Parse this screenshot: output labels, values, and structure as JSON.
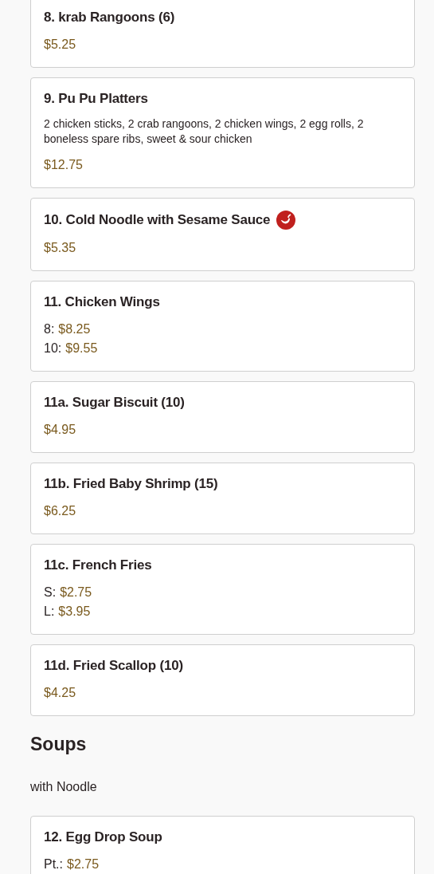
{
  "sections": [
    {
      "items": [
        {
          "name": "8. krab Rangoons (6)",
          "spicy": false,
          "prices": [
            {
              "price": "$5.25"
            }
          ]
        },
        {
          "name": "9. Pu Pu Platters",
          "spicy": false,
          "description": "2 chicken sticks, 2 crab rangoons, 2 chicken wings, 2 egg rolls, 2 boneless spare ribs, sweet & sour chicken",
          "prices": [
            {
              "price": "$12.75"
            }
          ]
        },
        {
          "name": "10. Cold Noodle with Sesame Sauce",
          "spicy": true,
          "prices": [
            {
              "price": "$5.35"
            }
          ]
        },
        {
          "name": "11. Chicken Wings",
          "spicy": false,
          "prices": [
            {
              "label": "8:",
              "price": "$8.25"
            },
            {
              "label": "10:",
              "price": "$9.55"
            }
          ]
        },
        {
          "name": "11a. Sugar Biscuit (10)",
          "spicy": false,
          "prices": [
            {
              "price": "$4.95"
            }
          ]
        },
        {
          "name": "11b. Fried Baby Shrimp (15)",
          "spicy": false,
          "prices": [
            {
              "price": "$6.25"
            }
          ]
        },
        {
          "name": "11c. French Fries",
          "spicy": false,
          "prices": [
            {
              "label": "S:",
              "price": "$2.75"
            },
            {
              "label": "L:",
              "price": "$3.95"
            }
          ]
        },
        {
          "name": "11d. Fried Scallop (10)",
          "spicy": false,
          "prices": [
            {
              "price": "$4.25"
            }
          ]
        }
      ]
    },
    {
      "title": "Soups",
      "subtitle": "with Noodle",
      "items": [
        {
          "name": "12. Egg Drop Soup",
          "spicy": false,
          "prices": [
            {
              "label": "Pt.:",
              "price": "$2.75"
            }
          ]
        }
      ]
    }
  ]
}
